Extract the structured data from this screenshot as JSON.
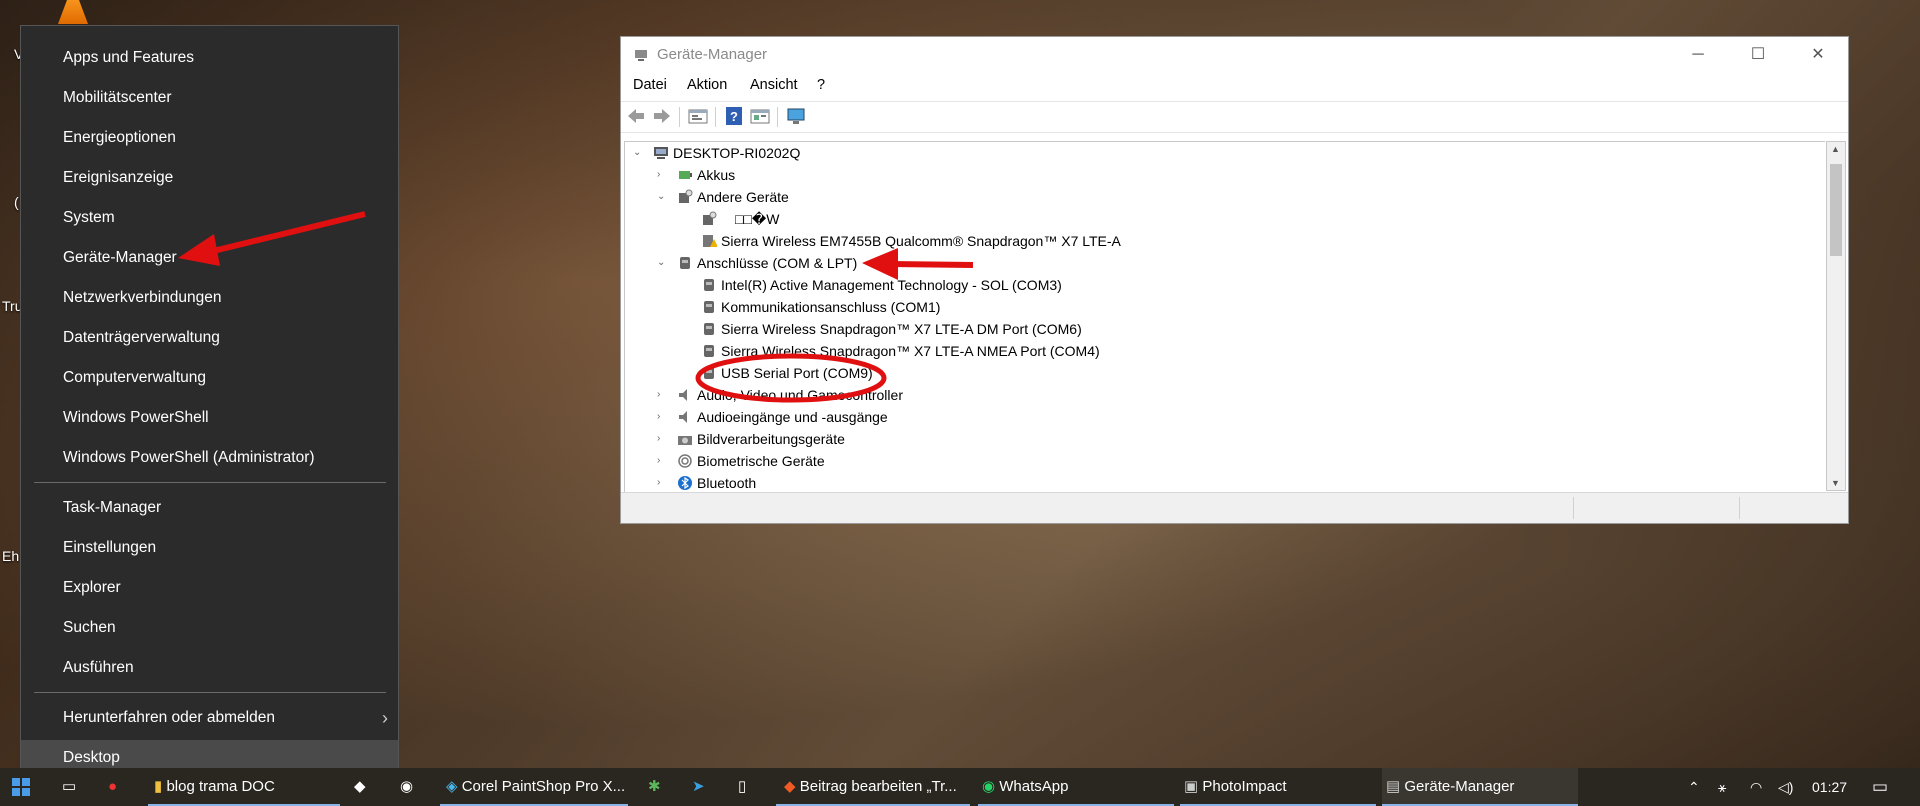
{
  "context_menu": {
    "group1": [
      "Apps und Features",
      "Mobilitätscenter",
      "Energieoptionen",
      "Ereignisanzeige",
      "System",
      "Geräte-Manager",
      "Netzwerkverbindungen",
      "Datenträgerverwaltung",
      "Computerverwaltung",
      "Windows PowerShell",
      "Windows PowerShell (Administrator)"
    ],
    "group2": [
      "Task-Manager",
      "Einstellungen",
      "Explorer",
      "Suchen",
      "Ausführen"
    ],
    "shutdown": "Herunterfahren oder abmelden",
    "desktop": "Desktop"
  },
  "desktop_fragments": {
    "a": "V",
    "b": "(",
    "c": "Tru",
    "d": "Eh"
  },
  "window": {
    "title": "Geräte-Manager",
    "controls": {
      "minimize": "─",
      "maximize": "☐",
      "close": "✕"
    },
    "menu": {
      "datei": "Datei",
      "aktion": "Aktion",
      "ansicht": "Ansicht",
      "help": "?"
    },
    "tree": {
      "root": "DESKTOP-RI0202Q",
      "akkus": "Akkus",
      "andere": "Andere Geräte",
      "unknown": "□□�W",
      "sierra_em": "Sierra Wireless EM7455B Qualcomm® Snapdragon™ X7 LTE-A",
      "anschluesse": "Anschlüsse (COM & LPT)",
      "intel": "Intel(R) Active Management Technology - SOL (COM3)",
      "komm": "Kommunikationsanschluss (COM1)",
      "sierra_dm": "Sierra Wireless Snapdragon™ X7 LTE-A DM Port (COM6)",
      "sierra_nmea": "Sierra Wireless Snapdragon™ X7 LTE-A NMEA Port (COM4)",
      "usb_serial": "USB Serial Port (COM9)",
      "audio_video": "Audio, Video und Gamecontroller",
      "audio_io": "Audioeingänge und -ausgänge",
      "bild": "Bildverarbeitungsgeräte",
      "bio": "Biometrische Geräte",
      "bt": "Bluetooth"
    }
  },
  "taskbar": {
    "blog": "blog trama DOC",
    "corel": "Corel PaintShop Pro X...",
    "brave": "Beitrag bearbeiten „Tr...",
    "whatsapp": "WhatsApp",
    "photoimpact": "PhotoImpact",
    "geraete": "Geräte-Manager",
    "clock": "01:27"
  },
  "colors": {
    "annotation_red": "#e01010",
    "menu_bg": "#2b2b2b",
    "taskbar_bg": "#2a2620"
  }
}
